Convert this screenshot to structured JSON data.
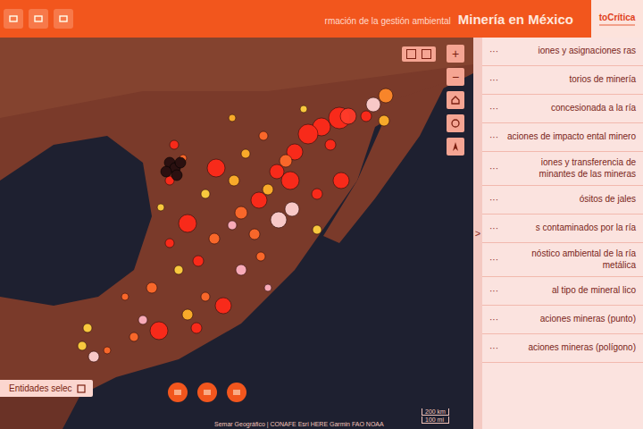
{
  "header": {
    "title": "Minería en México",
    "subtitle": "rmación de la gestión ambiental",
    "logo": "toCrítica"
  },
  "map": {
    "zoom": [
      "+",
      "−"
    ],
    "filter_button": "Entidades selec",
    "attribution": "Semar Geográfico | CONAFE Esri HERE Garmin FAO NOAA",
    "scale": [
      "200 km",
      "100 mi"
    ]
  },
  "panel_toggle": ">",
  "sidebar": {
    "more": "···",
    "items": [
      {
        "label": "iones y asignaciones ras"
      },
      {
        "label": "torios de minería"
      },
      {
        "label": "concesionada a la ría"
      },
      {
        "label": "aciones de impacto ental minero"
      },
      {
        "label": "iones y transferencia de minantes de las mineras"
      },
      {
        "label": "ósitos de jales"
      },
      {
        "label": "s contaminados por la ría"
      },
      {
        "label": "nóstico ambiental de la ría metálica"
      },
      {
        "label": "al tipo de mineral lico"
      },
      {
        "label": "aciones mineras (punto)"
      },
      {
        "label": "aciones mineras (polígono)"
      }
    ]
  }
}
